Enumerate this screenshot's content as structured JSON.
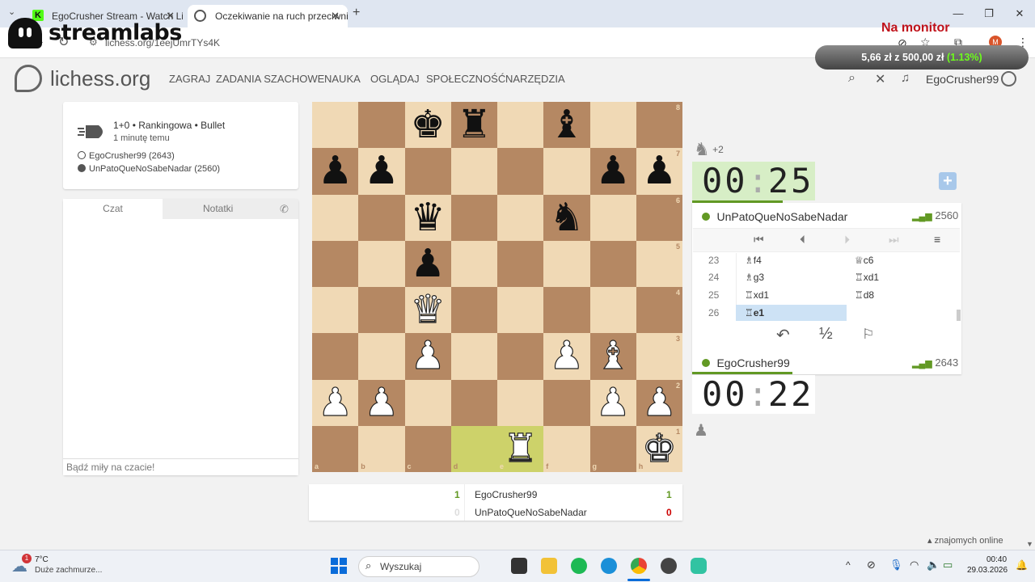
{
  "browser": {
    "tabs": [
      {
        "label": "EgoCrusher Stream - Watch Live"
      },
      {
        "label": "Oczekiwanie na ruch przeciwnika"
      }
    ],
    "url": "lichess.org/1eejUmrTYs4K"
  },
  "overlay": {
    "brand": "streamlabs",
    "monitor_label": "Na monitor",
    "donation_amount": "5,66 zł",
    "donation_sep": "z",
    "donation_goal": "500,00 zł",
    "donation_pct": "(1.13%)"
  },
  "site": {
    "logo": "lichess.org",
    "nav": [
      "ZAGRAJ",
      "ZADANIA SZACHOWE",
      "NAUKA",
      "OGLĄDAJ",
      "SPOŁECZNOŚĆ",
      "NARZĘDZIA"
    ],
    "username": "EgoCrusher99"
  },
  "game_info": {
    "type": "1+0 • Rankingowa • Bullet",
    "time": "1 minutę temu",
    "white": "EgoCrusher99 (2643)",
    "black": "UnPatoQueNoSabeNadar (2560)"
  },
  "chat": {
    "tab_chat": "Czat",
    "tab_notes": "Notatki",
    "placeholder": "Bądź miły na czacie!"
  },
  "board": {
    "pieces": [
      {
        "sq": "c8",
        "g": "♚",
        "c": "b"
      },
      {
        "sq": "d8",
        "g": "♜",
        "c": "b"
      },
      {
        "sq": "f8",
        "g": "♝",
        "c": "b"
      },
      {
        "sq": "a7",
        "g": "♟",
        "c": "b"
      },
      {
        "sq": "b7",
        "g": "♟",
        "c": "b"
      },
      {
        "sq": "g7",
        "g": "♟",
        "c": "b"
      },
      {
        "sq": "h7",
        "g": "♟",
        "c": "b"
      },
      {
        "sq": "c6",
        "g": "♛",
        "c": "b"
      },
      {
        "sq": "f6",
        "g": "♞",
        "c": "b"
      },
      {
        "sq": "c5",
        "g": "♟",
        "c": "b"
      },
      {
        "sq": "c4",
        "g": "♛",
        "c": "w"
      },
      {
        "sq": "c3",
        "g": "♟",
        "c": "w"
      },
      {
        "sq": "f3",
        "g": "♟",
        "c": "w"
      },
      {
        "sq": "g3",
        "g": "♝",
        "c": "w"
      },
      {
        "sq": "a2",
        "g": "♟",
        "c": "w"
      },
      {
        "sq": "b2",
        "g": "♟",
        "c": "w"
      },
      {
        "sq": "g2",
        "g": "♟",
        "c": "w"
      },
      {
        "sq": "h2",
        "g": "♟",
        "c": "w"
      },
      {
        "sq": "e1",
        "g": "♜",
        "c": "w"
      },
      {
        "sq": "h1",
        "g": "♚",
        "c": "w"
      }
    ],
    "highlight": [
      "d1",
      "e1"
    ],
    "files": [
      "a",
      "b",
      "c",
      "d",
      "e",
      "f",
      "g",
      "h"
    ],
    "ranks": [
      "8",
      "7",
      "6",
      "5",
      "4",
      "3",
      "2",
      "1"
    ]
  },
  "score": {
    "rows": [
      {
        "left": "1",
        "name": "EgoCrusher99",
        "right": "1"
      },
      {
        "left": "0",
        "name": "UnPatoQueNoSabeNadar",
        "right": "0"
      }
    ]
  },
  "right": {
    "material": "+2",
    "clock_top_min": "00",
    "clock_top_sec": "25",
    "clock_bot_min": "00",
    "clock_bot_sec": "22",
    "top_player": "UnPatoQueNoSabeNadar",
    "top_rating": "2560",
    "bottom_player": "EgoCrusher99",
    "bottom_rating": "2643",
    "moves": [
      {
        "n": "23",
        "w": "♗f4",
        "b": "♕c6"
      },
      {
        "n": "24",
        "w": "♗g3",
        "b": "♖xd1"
      },
      {
        "n": "25",
        "w": "♖xd1",
        "b": "♖d8"
      },
      {
        "n": "26",
        "w": "♖e1",
        "b": ""
      }
    ],
    "draw_label": "½",
    "friends_online": "znajomych online"
  },
  "taskbar": {
    "weather_badge": "1",
    "temp": "7°C",
    "weather": "Duże zachmurze...",
    "search": "Wyszukaj",
    "time": "00:40",
    "date": "29.03.2026"
  },
  "colors": {
    "accent_green": "#629924",
    "loss_red": "#cc0000",
    "board_light": "#f0d9b5",
    "board_dark": "#b58863",
    "highlight": "#cdd26a"
  }
}
